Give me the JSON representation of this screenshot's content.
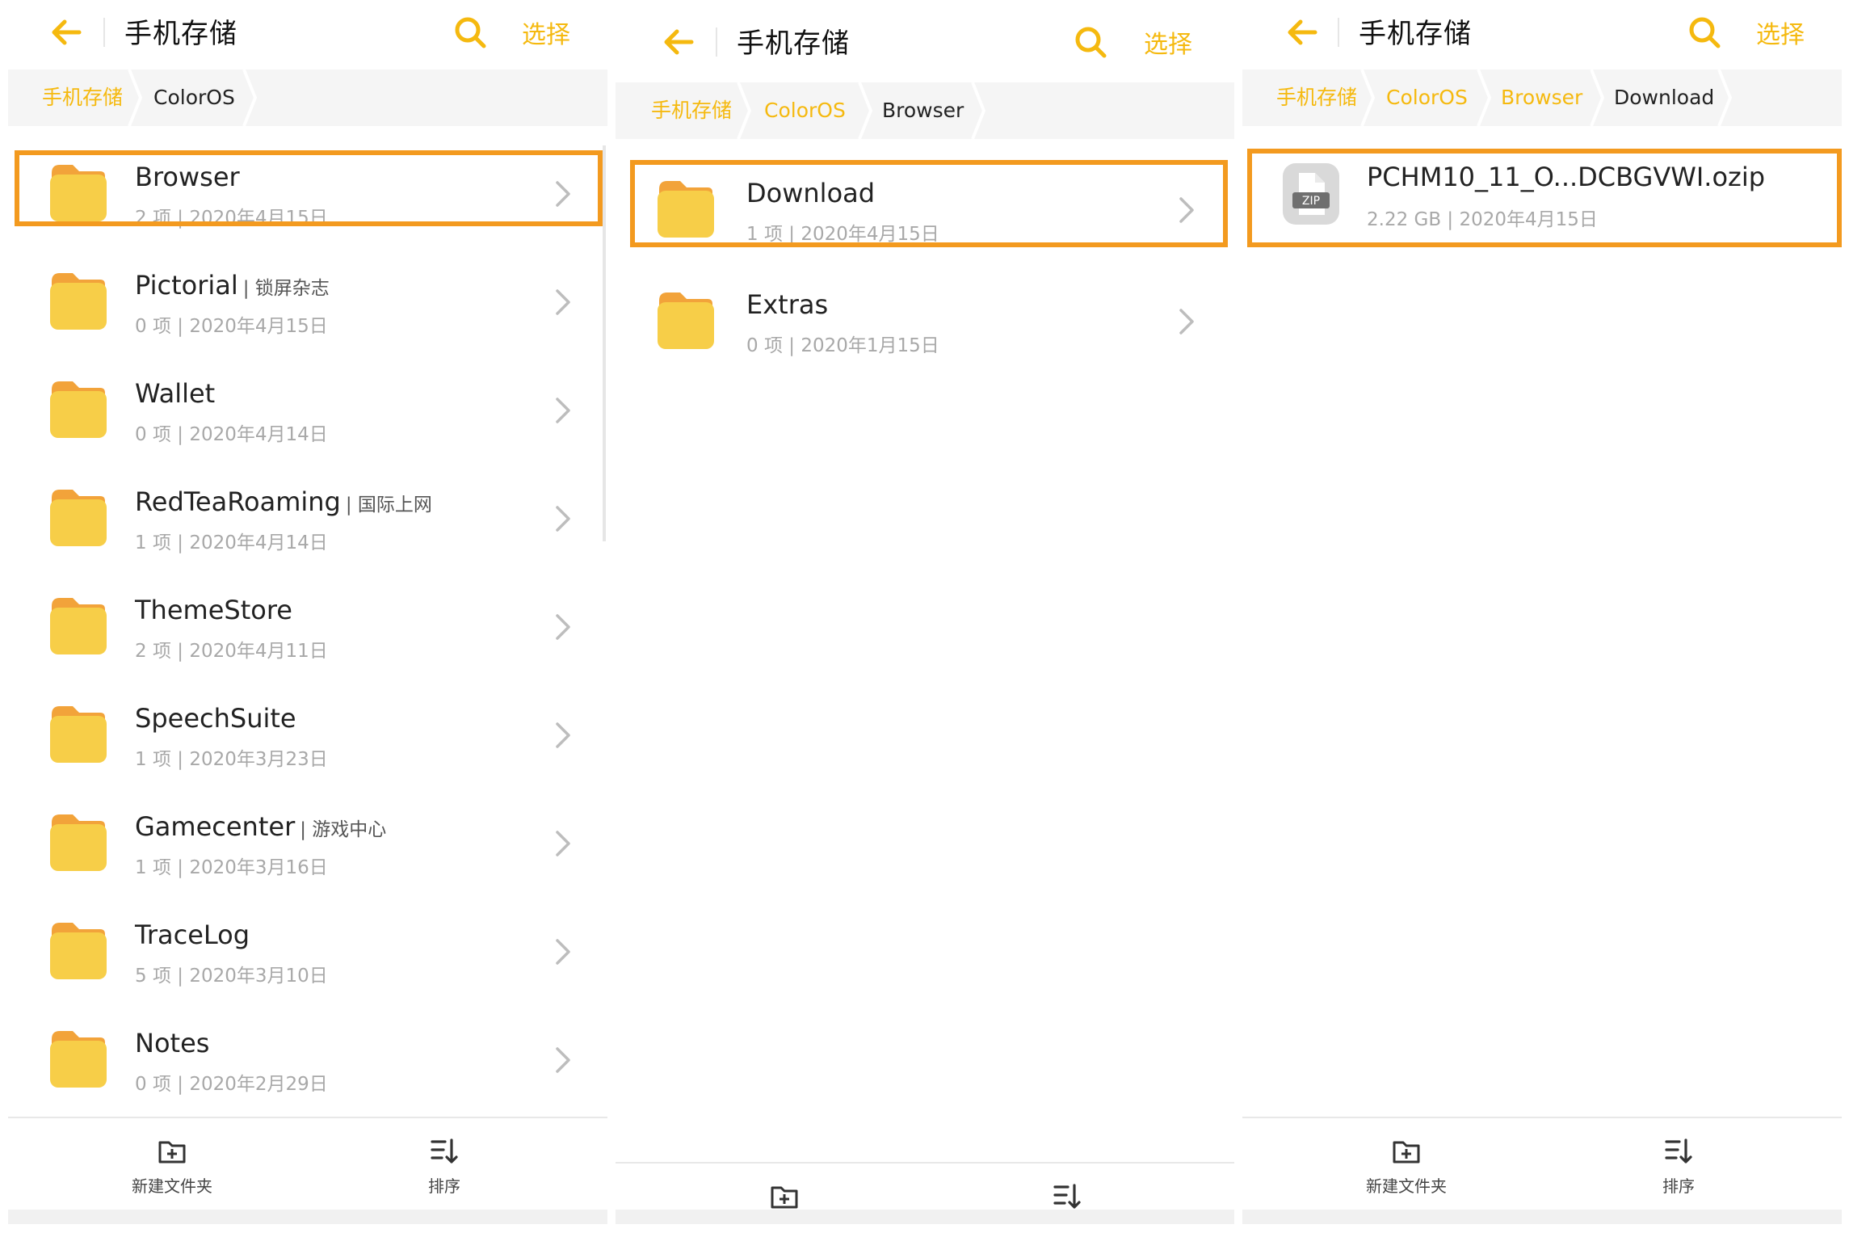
{
  "colors": {
    "accent": "#F5B90F",
    "highlight": "#F39A1F",
    "folder": "#F7CE48",
    "folder_tab": "#F2A33A"
  },
  "icons": {
    "back": "arrow-left-icon",
    "search": "search-icon",
    "folder": "folder-icon",
    "chevron": "chevron-right-icon",
    "zip": "zip-file-icon",
    "new_folder": "new-folder-icon",
    "sort": "sort-icon"
  },
  "panel1": {
    "title": "手机存储",
    "select_label": "选择",
    "breadcrumbs": [
      "手机存储",
      "ColorOS"
    ],
    "items": [
      {
        "name": "Browser",
        "tag": "",
        "meta": "2 项 | 2020年4月15日"
      },
      {
        "name": "Pictorial",
        "tag": "| 锁屏杂志",
        "meta": "0 项 | 2020年4月15日"
      },
      {
        "name": "Wallet",
        "tag": "",
        "meta": "0 项 | 2020年4月14日"
      },
      {
        "name": "RedTeaRoaming",
        "tag": "| 国际上网",
        "meta": "1 项 | 2020年4月14日"
      },
      {
        "name": "ThemeStore",
        "tag": "",
        "meta": "2 项 | 2020年4月11日"
      },
      {
        "name": "SpeechSuite",
        "tag": "",
        "meta": "1 项 | 2020年3月23日"
      },
      {
        "name": "Gamecenter",
        "tag": "| 游戏中心",
        "meta": "1 项 | 2020年3月16日"
      },
      {
        "name": "TraceLog",
        "tag": "",
        "meta": "5 项 | 2020年3月10日"
      },
      {
        "name": "Notes",
        "tag": "",
        "meta": "0 项 | 2020年2月29日"
      }
    ],
    "toolbar": {
      "new_folder_label": "新建文件夹",
      "sort_label": "排序"
    }
  },
  "panel2": {
    "title": "手机存储",
    "select_label": "选择",
    "breadcrumbs": [
      "手机存储",
      "ColorOS",
      "Browser"
    ],
    "items": [
      {
        "name": "Download",
        "meta": "1 项 | 2020年4月15日"
      },
      {
        "name": "Extras",
        "meta": "0 项 | 2020年1月15日"
      }
    ]
  },
  "panel3": {
    "title": "手机存储",
    "select_label": "选择",
    "breadcrumbs": [
      "手机存储",
      "ColorOS",
      "Browser",
      "Download"
    ],
    "file": {
      "icon_text": "ZIP",
      "name": "PCHM10_11_O...DCBGVWI.ozip",
      "meta": "2.22 GB | 2020年4月15日"
    },
    "toolbar": {
      "new_folder_label": "新建文件夹",
      "sort_label": "排序"
    }
  }
}
